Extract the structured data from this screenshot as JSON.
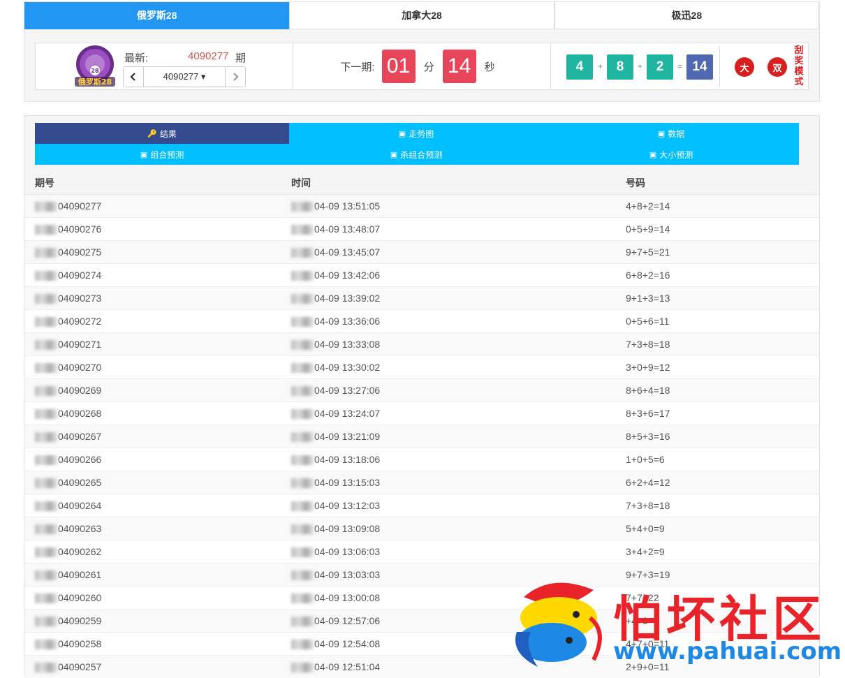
{
  "game_tabs": [
    {
      "label": "俄罗斯28",
      "active": true
    },
    {
      "label": "加拿大28",
      "active": false
    },
    {
      "label": "极迅28",
      "active": false
    }
  ],
  "latest": {
    "logo_text": "俄罗斯28",
    "logo_badge": "28",
    "label": "最新:",
    "number": "4090277",
    "suffix": "期",
    "selected_issue": "4090277 ▾",
    "prev_icon": "chevron-left-icon",
    "next_icon": "chevron-right-icon"
  },
  "countdown": {
    "label": "下一期:",
    "minutes": "01",
    "minutes_unit": "分",
    "seconds": "14",
    "seconds_unit": "秒"
  },
  "result": {
    "n1": "4",
    "plus1": "+",
    "n2": "8",
    "plus2": "+",
    "n3": "2",
    "eq": "=",
    "sum": "14",
    "badge_size": "大",
    "badge_parity": "双",
    "mode_text": "刮奖模式"
  },
  "nav": [
    {
      "label": "结果",
      "icon": "key-icon",
      "active": true
    },
    {
      "label": "走势图",
      "icon": "image-icon",
      "active": false
    },
    {
      "label": "数据",
      "icon": "image-icon",
      "active": false
    },
    {
      "label": "组合预测",
      "icon": "image-icon",
      "active": false
    },
    {
      "label": "杀组合预测",
      "icon": "image-icon",
      "active": false
    },
    {
      "label": "大小预测",
      "icon": "image-icon",
      "active": false
    }
  ],
  "table": {
    "headers": [
      "期号",
      "时间",
      "号码"
    ],
    "rows": [
      [
        "04090277",
        "04-09 13:51:05",
        "4+8+2=14"
      ],
      [
        "04090276",
        "04-09 13:48:07",
        "0+5+9=14"
      ],
      [
        "04090275",
        "04-09 13:45:07",
        "9+7+5=21"
      ],
      [
        "04090274",
        "04-09 13:42:06",
        "6+8+2=16"
      ],
      [
        "04090273",
        "04-09 13:39:02",
        "9+1+3=13"
      ],
      [
        "04090272",
        "04-09 13:36:06",
        "0+5+6=11"
      ],
      [
        "04090271",
        "04-09 13:33:08",
        "7+3+8=18"
      ],
      [
        "04090270",
        "04-09 13:30:02",
        "3+0+9=12"
      ],
      [
        "04090269",
        "04-09 13:27:06",
        "8+6+4=18"
      ],
      [
        "04090268",
        "04-09 13:24:07",
        "8+3+6=17"
      ],
      [
        "04090267",
        "04-09 13:21:09",
        "8+5+3=16"
      ],
      [
        "04090266",
        "04-09 13:18:06",
        "1+0+5=6"
      ],
      [
        "04090265",
        "04-09 13:15:03",
        "6+2+4=12"
      ],
      [
        "04090264",
        "04-09 13:12:03",
        "7+3+8=18"
      ],
      [
        "04090263",
        "04-09 13:09:08",
        "5+4+0=9"
      ],
      [
        "04090262",
        "04-09 13:06:03",
        "3+4+2=9"
      ],
      [
        "04090261",
        "04-09 13:03:03",
        "9+7+3=19"
      ],
      [
        "04090260",
        "04-09 13:00:08",
        "7+7+22"
      ],
      [
        "04090259",
        "04-09 12:57:06",
        "+4+9"
      ],
      [
        "04090258",
        "04-09 12:54:08",
        "4+7+0=11"
      ],
      [
        "04090257",
        "04-09 12:51:04",
        "2+9+0=11"
      ]
    ]
  },
  "watermark": {
    "title": "怕坏社区",
    "url": "www.pahuai.com"
  },
  "colors": {
    "tab_active": "#2196f3",
    "nav_active": "#344a8e",
    "nav": "#00bfff",
    "countdown": "#e8445a",
    "ball": "#1fb5a0",
    "sum_ball": "#5068b2",
    "badge": "#d81e1e",
    "highlight": "#d9534f"
  }
}
